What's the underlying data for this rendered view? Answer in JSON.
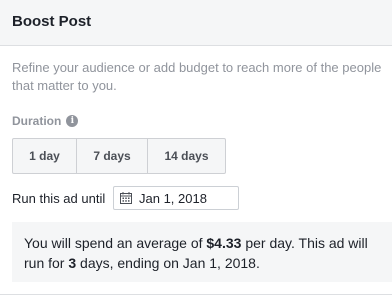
{
  "header": {
    "title": "Boost Post"
  },
  "description": "Refine your audience or add budget to reach more of the people that matter to you.",
  "duration": {
    "label": "Duration",
    "info_icon": "info-icon",
    "options": [
      "1 day",
      "7 days",
      "14 days"
    ]
  },
  "run_until": {
    "label": "Run this ad until",
    "date_value": "Jan 1, 2018",
    "icon": "calendar-icon"
  },
  "summary": {
    "part1": "You will spend an average of ",
    "amount": "$4.33",
    "part2": " per day. This ad will run for ",
    "days": "3",
    "part3": " days, ending on Jan 1, 2018."
  },
  "colors": {
    "header_bg": "#f5f6f7",
    "muted_text": "#90949c",
    "border": "#ced0d4",
    "text": "#1d2129"
  }
}
